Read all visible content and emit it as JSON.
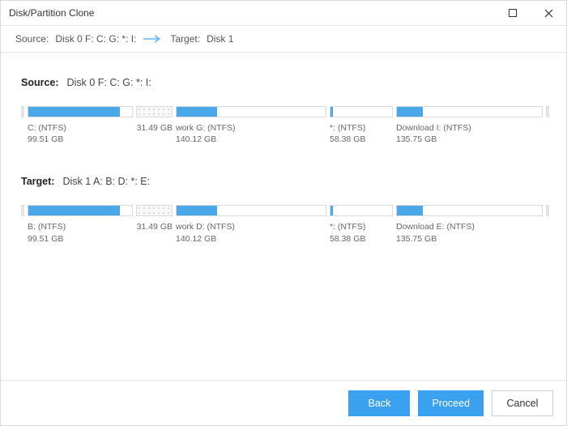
{
  "window": {
    "title": "Disk/Partition Clone"
  },
  "subheader": {
    "source_label": "Source:",
    "source_value": "Disk 0 F: C: G: *: I:",
    "target_label": "Target:",
    "target_value": "Disk 1"
  },
  "source": {
    "label": "Source:",
    "value": "Disk 0 F: C: G: *: I:",
    "partitions": [
      {
        "name": "C: (NTFS)",
        "size": "99.51 GB"
      },
      {
        "name": "",
        "size": "31.49 GB"
      },
      {
        "name": "work G: (NTFS)",
        "size": "140.12 GB"
      },
      {
        "name": "*: (NTFS)",
        "size": "58.38 GB"
      },
      {
        "name": "Download I: (NTFS)",
        "size": "135.75 GB"
      }
    ]
  },
  "target": {
    "label": "Target:",
    "value": "Disk 1 A: B: D: *: E:",
    "partitions": [
      {
        "name": "B: (NTFS)",
        "size": "99.51 GB"
      },
      {
        "name": "",
        "size": "31.49 GB"
      },
      {
        "name": "work D: (NTFS)",
        "size": "140.12 GB"
      },
      {
        "name": "*: (NTFS)",
        "size": "58.38 GB"
      },
      {
        "name": "Download E: (NTFS)",
        "size": "135.75 GB"
      }
    ]
  },
  "buttons": {
    "back": "Back",
    "proceed": "Proceed",
    "cancel": "Cancel"
  }
}
